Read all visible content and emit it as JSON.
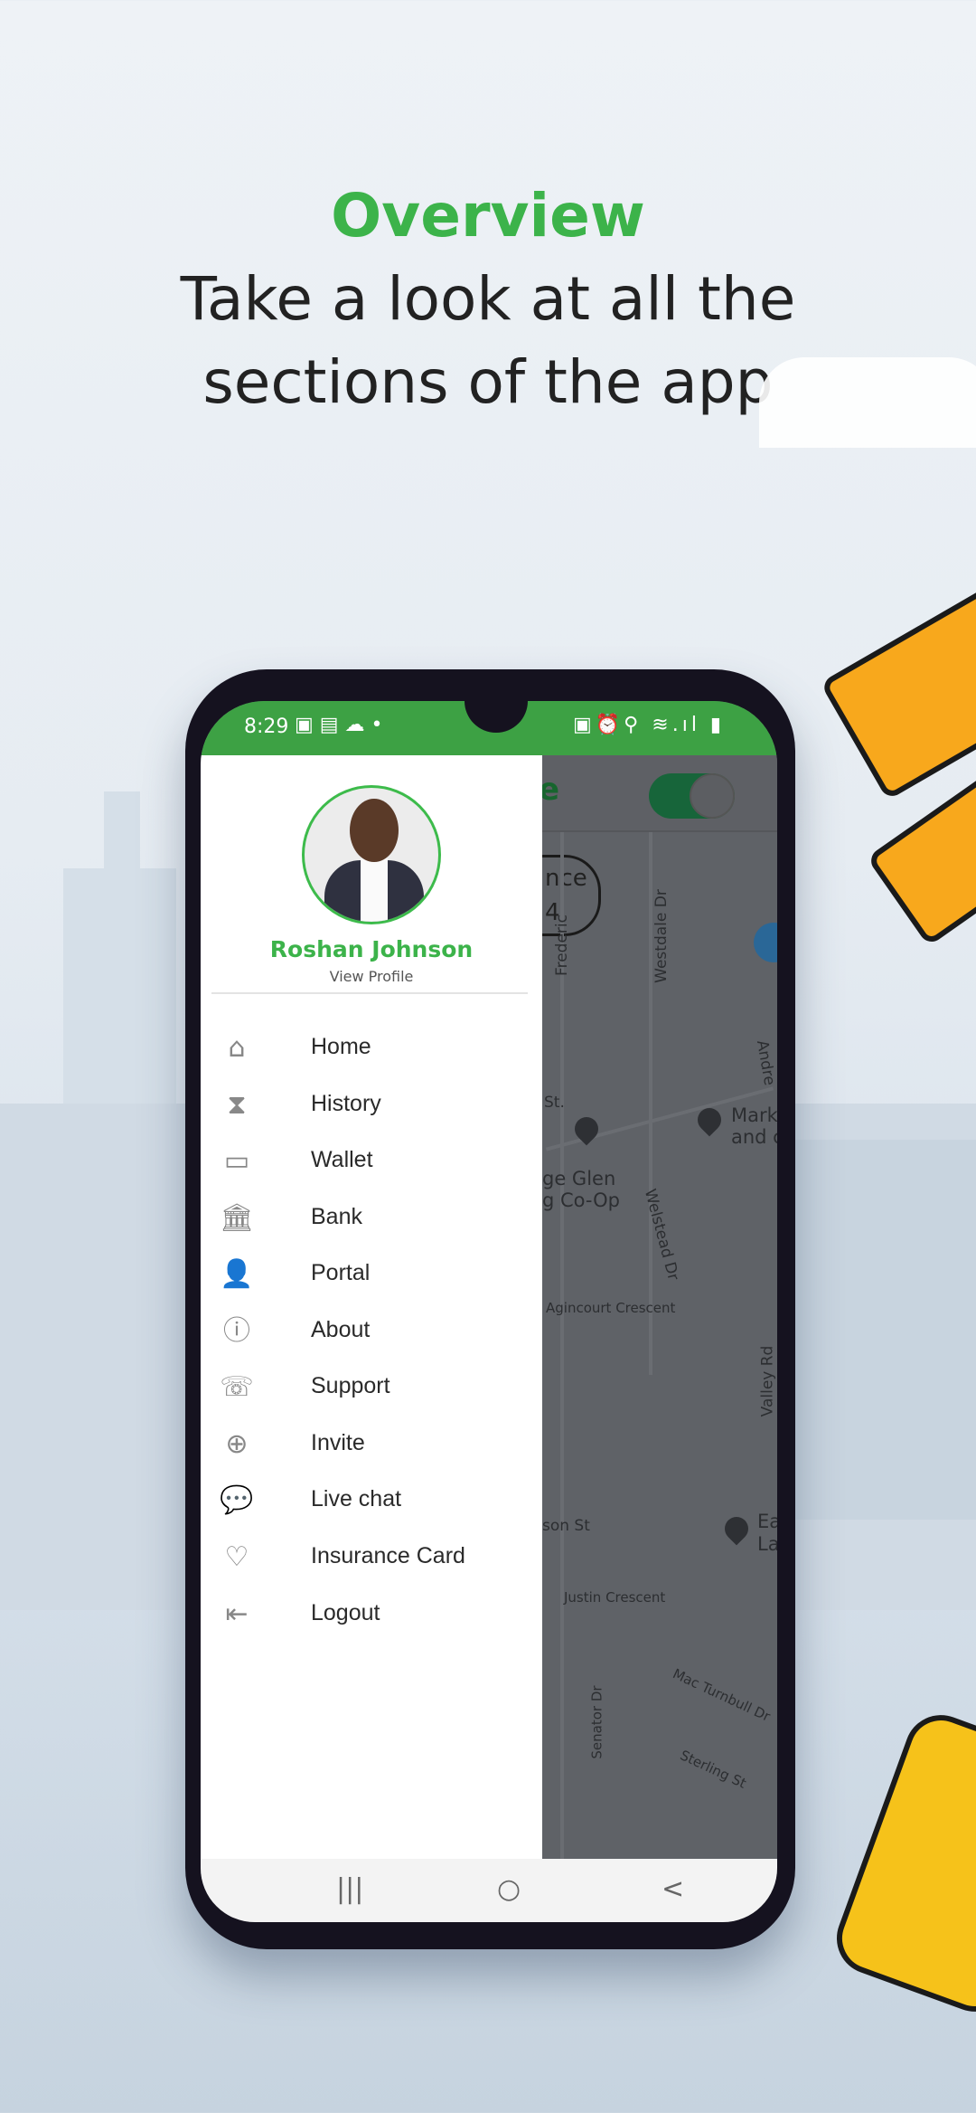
{
  "header": {
    "title": "Overview",
    "subtitle_line1": "Take a look at all the",
    "subtitle_line2": "sections of the app"
  },
  "colors": {
    "accent": "#3cb34a",
    "status_bar": "#3da144",
    "toggle": "#17653a"
  },
  "status_bar": {
    "time": "8:29",
    "left_icons": [
      "image-icon",
      "sim-icon",
      "cloud-icon",
      "dot-icon"
    ],
    "right_icons": [
      "battery-saver-icon",
      "alarm-icon",
      "location-icon",
      "wifi-icon",
      "signal-icon",
      "battery-icon"
    ]
  },
  "drawer": {
    "user_name": "Roshan  Johnson",
    "view_profile": "View Profile",
    "items": [
      {
        "label": "Home",
        "icon": "home-icon"
      },
      {
        "label": "History",
        "icon": "hourglass-icon"
      },
      {
        "label": "Wallet",
        "icon": "wallet-icon"
      },
      {
        "label": "Bank",
        "icon": "bank-icon"
      },
      {
        "label": "Portal",
        "icon": "user-portal-icon"
      },
      {
        "label": "About",
        "icon": "info-icon"
      },
      {
        "label": "Support",
        "icon": "support-24-icon"
      },
      {
        "label": "Invite",
        "icon": "invite-user-icon"
      },
      {
        "label": "Live chat",
        "icon": "chat-icon"
      },
      {
        "label": "Insurance Card",
        "icon": "heart-icon"
      },
      {
        "label": "Logout",
        "icon": "logout-icon"
      }
    ]
  },
  "map": {
    "title_partial": "e",
    "toggle_on": true,
    "pill_line1": "nce",
    "pill_line2": "4",
    "labels": {
      "frederic": "Frederic",
      "westdale": "Westdale Dr",
      "andre": "Andre",
      "st": "St.",
      "glen1": "ge Glen",
      "glen2": "g Co-Op",
      "mark1": "Mark",
      "mark2": "and c",
      "welstead": "Welstead Dr",
      "agincourt": "Agincourt Crescent",
      "valley": "Valley Rd",
      "son": "son St",
      "ea": "Ea",
      "la": "La",
      "justin": "Justin Crescent",
      "mac": "Mac Turnbull Dr",
      "senator": "Senator Dr",
      "sterling": "Sterling St"
    }
  },
  "nav": {
    "recents": "|||",
    "home": "○",
    "back": "<"
  }
}
